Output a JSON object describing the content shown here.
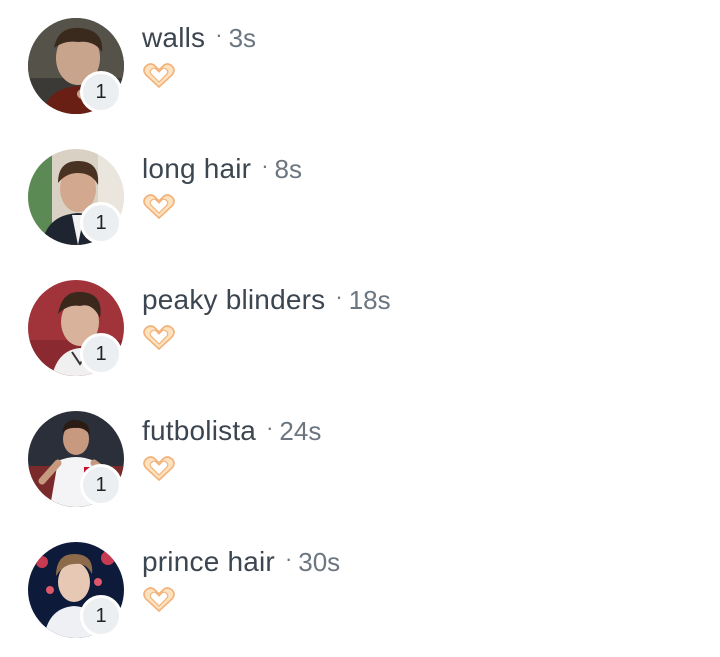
{
  "items": [
    {
      "name": "walls",
      "separator": "·",
      "time": "3s",
      "badge": "1",
      "avatar": "portrait-dark-background",
      "reaction": "heart-hands-icon"
    },
    {
      "name": "long hair",
      "separator": "·",
      "time": "8s",
      "badge": "1",
      "avatar": "portrait-indoors-suit",
      "reaction": "heart-hands-icon"
    },
    {
      "name": "peaky blinders",
      "separator": "·",
      "time": "18s",
      "badge": "1",
      "avatar": "portrait-red-background",
      "reaction": "heart-hands-icon"
    },
    {
      "name": "futbolista",
      "separator": "·",
      "time": "24s",
      "badge": "1",
      "avatar": "portrait-football-kit",
      "reaction": "heart-hands-icon"
    },
    {
      "name": "prince hair",
      "separator": "·",
      "time": "30s",
      "badge": "1",
      "avatar": "portrait-stage-lights",
      "reaction": "heart-hands-icon"
    }
  ],
  "colors": {
    "name": "#3c4650",
    "meta": "#6b7680",
    "badge_bg": "#eceff1",
    "reaction": "#f7c48a"
  }
}
